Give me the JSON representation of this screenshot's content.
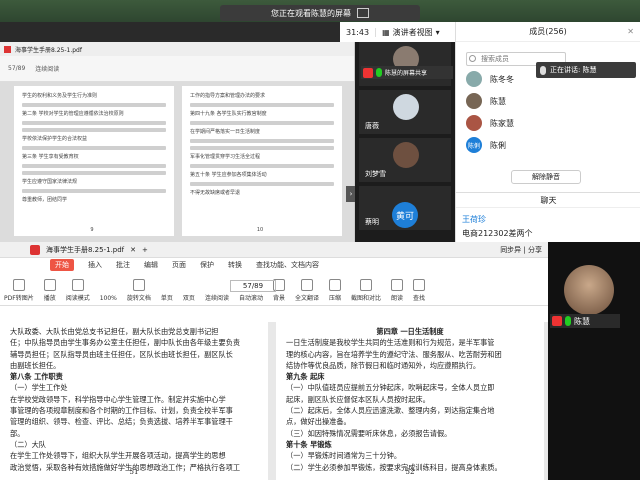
{
  "banner": {
    "text": "您正在观看陈慧的屏幕"
  },
  "meetbar": {
    "time": "31:43",
    "view": "演讲者视图"
  },
  "pdf1": {
    "filename": "海事学生手册8.25-1.pdf",
    "page": "57/89",
    "mode": "连续阅读",
    "page_left": "9",
    "page_right": "10",
    "left_lines": [
      "学生的权利和义务及学生行为准则",
      "第二条 学校对学生的管理应遵循依法治校原则",
      "学校依法保护学生的合法权益",
      "第三条 学生享有受教育权",
      "学生应遵守国家法律法规",
      "尊重教师，团结同学"
    ],
    "right_lines": [
      "工作的指导方案和管理办法的要求",
      "第四十九条 各学生队实行教官制度",
      "在学期间严格落实一日生活制度",
      "军事化管理贯穿学习生活全过程",
      "第五十条 学生应参加各项集体活动",
      "不得无故缺席或者早退"
    ]
  },
  "videos": {
    "share_label": "陈慧的屏幕共享",
    "names": [
      "唐薇",
      "刘梦雪",
      "黄可",
      "蔡明"
    ]
  },
  "panel": {
    "title": "成员(256)",
    "search_placeholder": "搜索成员",
    "speaking": "正在讲话: 陈慧",
    "members": [
      "陈冬冬",
      "陈慧",
      "陈家慧",
      "陈俐"
    ],
    "member_badge": "陈俐",
    "mute_all": "解除静音",
    "chat_title": "聊天",
    "chat_name": "王荷珍",
    "chat_msg": "电商212302差两个"
  },
  "pdf2": {
    "filename": "海事学生手册8.25-1.pdf",
    "tab_right": "同步异 | 分享",
    "menu": [
      "开始",
      "插入",
      "批注",
      "编辑",
      "页面",
      "保护",
      "转换",
      "查找功能、文档内容"
    ],
    "ribbon": [
      "PDF转图片",
      "播放",
      "阅读模式",
      "旋转文档",
      "单页",
      "双页",
      "连续阅读",
      "自动滚动",
      "背景",
      "全文翻译",
      "压缩",
      "截图和对比",
      "朗读",
      "查找"
    ],
    "zoom": "100%",
    "page": "57/89",
    "left_page": [
      "大队政委、大队长由党总支书记担任，副大队长由党总支副书记担",
      "任；中队指导员由学生事务办公室主任担任，副中队长由各年级主要负责",
      "辅导员担任；区队指导员由班主任担任，区队长由班长担任，副区队长",
      "由副班长担任。",
      "第八条 工作职责",
      "（一）学生工作处",
      "在学校党政领导下，科学指导中心学生管理工作。制定并实施中心学",
      "事管理的各项规章制度和各个时期的工作目标、计划，负责全校半军事",
      "管理的组织、领导、检查、评比、总结；负责选拔、培养半军事管理干",
      "部。",
      "（二）大队",
      "在学生工作处领导下，组织大队学生开展各项活动，提高学生的思想",
      "政治觉悟，采取各种有效措施做好学生的思想政治工作；严格执行各项工",
      "作制度。"
    ],
    "right_page": [
      "第四章 一日生活制度",
      "一日生活制度是我校学生共同的生活准则和行为规范，是半军事管",
      "理的核心内容，旨在培养学生的遵纪守法、服务服从、吃苦耐劳和团",
      "结协作等优良品质，除节假日和临时通知外，均应遵照执行。",
      "第九条 起床",
      "（一）中队值班员应提前五分钟起床，吹哨起床号，全体人员立即",
      "起床，副区队长应督促本区队人员按时起床。",
      "（二）起床后，全体人员应迅速洗漱、整理内务，到达指定集合地",
      "点，做好出操准备。",
      "（三）如因特殊情况需要听床休息，必须报告请假。",
      "第十条 早锻炼",
      "（一）早锻炼时间通常为三十分钟。",
      "（二）学生必须参加早锻炼，按要求完成训练科目，提高身体素质。"
    ],
    "page_left": "51",
    "page_right": "52"
  },
  "vid2": {
    "name": "陈慧"
  }
}
